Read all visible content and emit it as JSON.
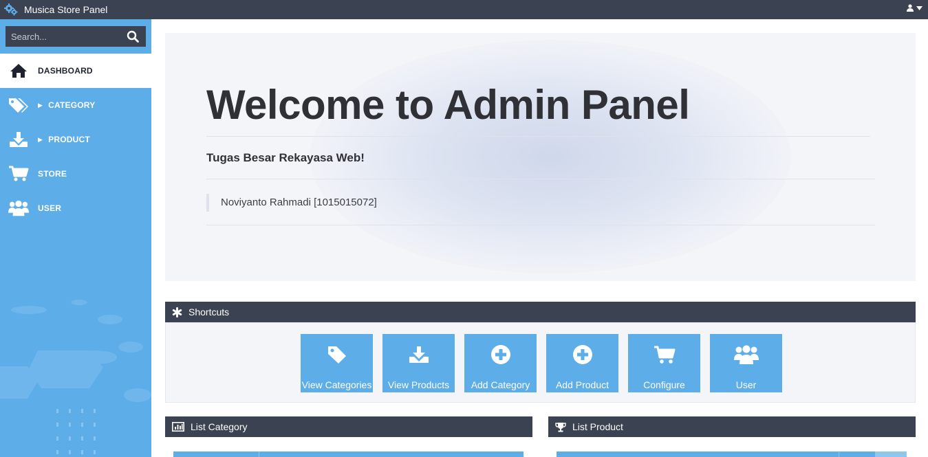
{
  "topbar": {
    "title": "Musica Store Panel"
  },
  "search": {
    "placeholder": "Search..."
  },
  "sidebar": {
    "items": [
      {
        "label": "DASHBOARD",
        "icon": "home-icon",
        "active": true,
        "has_caret": false
      },
      {
        "label": "CATEGORY",
        "icon": "tags-icon",
        "active": false,
        "has_caret": true
      },
      {
        "label": "PRODUCT",
        "icon": "download-icon",
        "active": false,
        "has_caret": true
      },
      {
        "label": "STORE",
        "icon": "cart-icon",
        "active": false,
        "has_caret": false
      },
      {
        "label": "USER",
        "icon": "users-icon",
        "active": false,
        "has_caret": false
      }
    ]
  },
  "jumbotron": {
    "title": "Welcome to Admin Panel",
    "subtitle": "Tugas Besar Rekayasa Web!",
    "quote": "Noviyanto Rahmadi [1015015072]"
  },
  "shortcuts": {
    "title": "Shortcuts",
    "tiles": [
      {
        "label": "View Categories",
        "icon": "tag-icon"
      },
      {
        "label": "View Products",
        "icon": "download-icon"
      },
      {
        "label": "Add Category",
        "icon": "plus-circle-icon"
      },
      {
        "label": "Add Product",
        "icon": "plus-circle-icon"
      },
      {
        "label": "Configure",
        "icon": "cart-icon"
      },
      {
        "label": "User",
        "icon": "users-icon"
      }
    ]
  },
  "panels": {
    "list_category": {
      "title": "List Category",
      "icon": "bar-chart-icon"
    },
    "list_product": {
      "title": "List Product",
      "icon": "trophy-icon"
    }
  },
  "colors": {
    "dark": "#3b4251",
    "accent": "#5dade8",
    "jumbotron_bg": "#f4f5f9"
  }
}
